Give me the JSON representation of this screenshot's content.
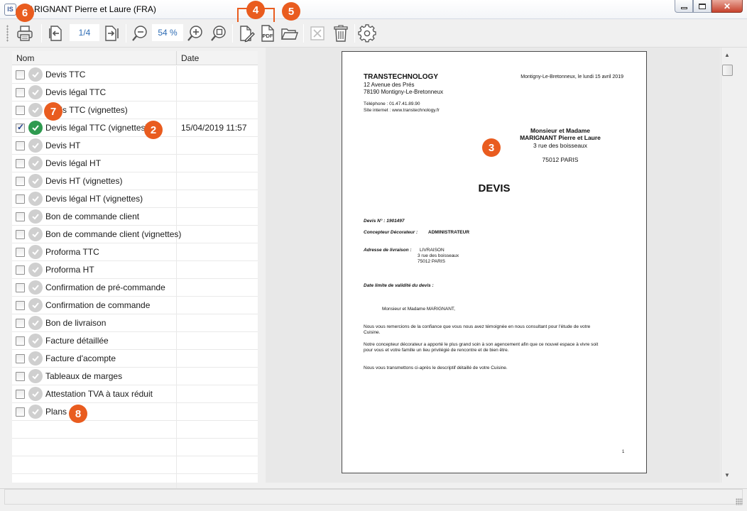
{
  "window": {
    "title": "MARIGNANT Pierre et Laure (FRA)",
    "app_icon_text": "IS"
  },
  "toolbar": {
    "page_indicator": "1/4",
    "zoom": "54 %",
    "pdf_label": "PDF"
  },
  "list": {
    "columns": {
      "name": "Nom",
      "date": "Date"
    },
    "rows": [
      {
        "label": "Devis TTC",
        "date": "",
        "checked": false,
        "status": "pending"
      },
      {
        "label": "Devis légal TTC",
        "date": "",
        "checked": false,
        "status": "pending"
      },
      {
        "label": "Devis TTC (vignettes)",
        "date": "",
        "checked": false,
        "status": "pending"
      },
      {
        "label": "Devis légal TTC (vignettes)",
        "date": "15/04/2019 11:57",
        "checked": true,
        "status": "done"
      },
      {
        "label": "Devis HT",
        "date": "",
        "checked": false,
        "status": "pending"
      },
      {
        "label": "Devis légal HT",
        "date": "",
        "checked": false,
        "status": "pending"
      },
      {
        "label": "Devis HT (vignettes)",
        "date": "",
        "checked": false,
        "status": "pending"
      },
      {
        "label": "Devis légal HT (vignettes)",
        "date": "",
        "checked": false,
        "status": "pending"
      },
      {
        "label": "Bon de commande client",
        "date": "",
        "checked": false,
        "status": "pending"
      },
      {
        "label": "Bon de commande client (vignettes)",
        "date": "",
        "checked": false,
        "status": "pending"
      },
      {
        "label": "Proforma TTC",
        "date": "",
        "checked": false,
        "status": "pending"
      },
      {
        "label": "Proforma HT",
        "date": "",
        "checked": false,
        "status": "pending"
      },
      {
        "label": "Confirmation de pré-commande",
        "date": "",
        "checked": false,
        "status": "pending"
      },
      {
        "label": "Confirmation de commande",
        "date": "",
        "checked": false,
        "status": "pending"
      },
      {
        "label": "Bon de livraison",
        "date": "",
        "checked": false,
        "status": "pending"
      },
      {
        "label": "Facture détaillée",
        "date": "",
        "checked": false,
        "status": "pending"
      },
      {
        "label": "Facture d'acompte",
        "date": "",
        "checked": false,
        "status": "pending"
      },
      {
        "label": "Tableaux de marges",
        "date": "",
        "checked": false,
        "status": "pending"
      },
      {
        "label": "Attestation TVA à taux réduit",
        "date": "",
        "checked": false,
        "status": "pending"
      },
      {
        "label": "Plans",
        "date": "",
        "checked": false,
        "status": "pending"
      }
    ]
  },
  "callouts": [
    "2",
    "3",
    "4",
    "5",
    "6",
    "7",
    "8"
  ],
  "document": {
    "company": "TRANSTECHNOLOGY",
    "address1": "12 Avenue des Prés",
    "address2": "78190 Montigny-Le-Bretonneux",
    "phone": "Téléphone : 01.47.41.89.90",
    "website": "Site internet : www.transtechnology.fr",
    "place_date": "Montigny-Le-Bretonneux, le lundi 15 avril 2019",
    "recipient_title": "Monsieur et Madame",
    "recipient_name": "MARIGNANT Pierre et Laure",
    "recipient_street": "3 rue des boisseaux",
    "recipient_city": "75012 PARIS",
    "heading": "DEVIS",
    "devis_no": "Devis N° : 1901497",
    "designer_label": "Concepteur Décorateur :",
    "designer_value": "ADMINISTRATEUR",
    "delivery_label": "Adresse de livraison :",
    "delivery_line1": "LIVRAISON",
    "delivery_line2": "3 rue des boisseaux",
    "delivery_line3": "75012 PARIS",
    "validity": "Date limite de validité du devis :",
    "salutation": "Monsieur et Madame MARIGNANT,",
    "para1_l1": "Nous vous remercions de la confiance que vous nous avez témoignée en nous consultant pour l'étude de votre",
    "para1_l2": "Cuisine.",
    "para2_l1": "Notre concepteur décorateur a apporté le plus grand soin à son agencement afin que ce nouvel espace à vivre soit",
    "para2_l2": "pour vous et votre famille un lieu privilégié de rencontre et de bien être.",
    "para3": "Nous vous transmettons ci-après le descriptif détaillé de votre Cuisine.",
    "page_number": "1"
  }
}
